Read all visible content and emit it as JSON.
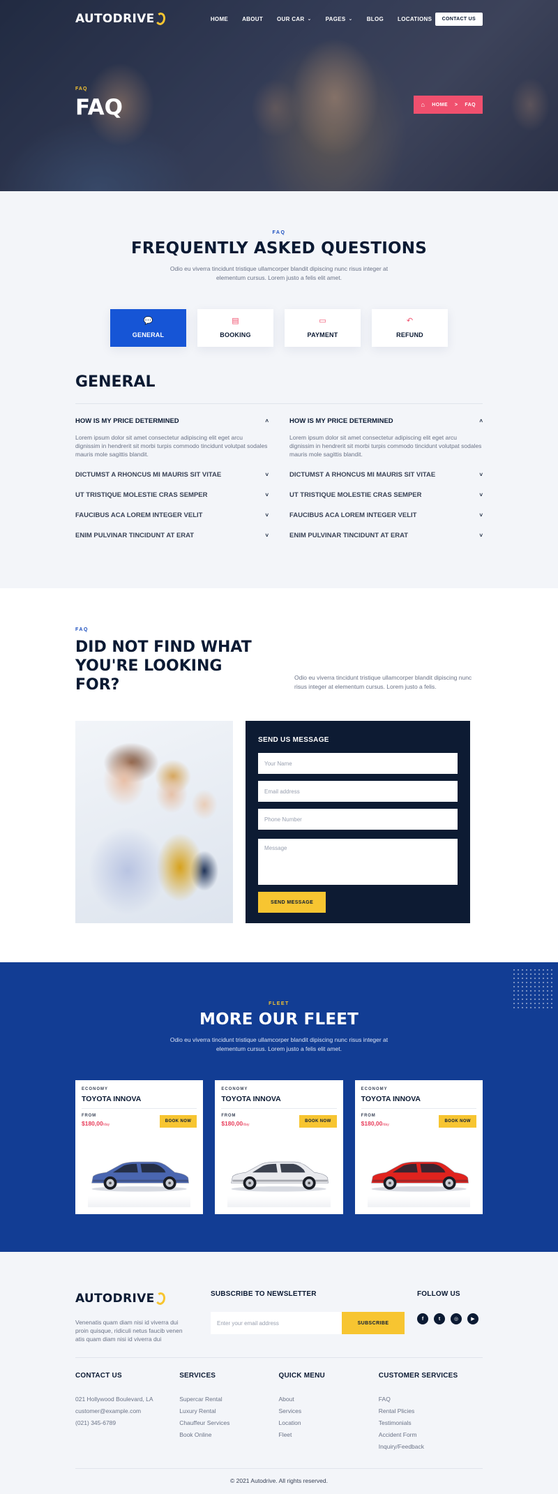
{
  "brand": {
    "name": "AUTODRIVE"
  },
  "nav": {
    "items": [
      {
        "label": "HOME",
        "dropdown": false
      },
      {
        "label": "ABOUT",
        "dropdown": false
      },
      {
        "label": "OUR CAR",
        "dropdown": true
      },
      {
        "label": "PAGES",
        "dropdown": true
      },
      {
        "label": "BLOG",
        "dropdown": false
      },
      {
        "label": "LOCATIONS",
        "dropdown": false
      }
    ],
    "cta": "CONTACT US"
  },
  "hero": {
    "eyebrow": "FAQ",
    "title": "FAQ",
    "breadcrumb": {
      "home": "HOME",
      "separator": ">",
      "current": "FAQ"
    }
  },
  "faq": {
    "eyebrow": "FAQ",
    "title": "FREQUENTLY ASKED QUESTIONS",
    "description": "Odio eu viverra tincidunt tristique ullamcorper blandit dipiscing nunc risus integer at elementum cursus. Lorem justo a felis elit amet.",
    "tabs": [
      {
        "label": "GENERAL",
        "icon": "chat-bubble-icon",
        "active": true
      },
      {
        "label": "BOOKING",
        "icon": "document-icon",
        "active": false
      },
      {
        "label": "PAYMENT",
        "icon": "card-icon",
        "active": false
      },
      {
        "label": "REFUND",
        "icon": "reply-arrow-icon",
        "active": false
      }
    ],
    "section_title": "GENERAL",
    "columns": [
      {
        "open_question": "HOW IS MY PRICE DETERMINED",
        "open_answer": "Lorem ipsum dolor sit amet consectetur adipiscing elit eget arcu dignissim in hendrerit sit morbi turpis commodo tincidunt volutpat sodales mauris mole sagittis blandit.",
        "questions": [
          "DICTUMST A RHONCUS MI MAURIS SIT VITAE",
          "UT TRISTIQUE MOLESTIE CRAS SEMPER",
          "FAUCIBUS ACA LOREM INTEGER VELIT",
          "ENIM PULVINAR TINCIDUNT AT ERAT"
        ]
      },
      {
        "open_question": "HOW IS MY PRICE DETERMINED",
        "open_answer": "Lorem ipsum dolor sit amet consectetur adipiscing elit eget arcu dignissim in hendrerit sit morbi turpis commodo tincidunt volutpat sodales mauris mole sagittis blandit.",
        "questions": [
          "DICTUMST A RHONCUS MI MAURIS SIT VITAE",
          "UT TRISTIQUE MOLESTIE CRAS SEMPER",
          "FAUCIBUS ACA LOREM INTEGER VELIT",
          "ENIM PULVINAR TINCIDUNT AT ERAT"
        ]
      }
    ]
  },
  "contact": {
    "eyebrow": "FAQ",
    "title": "DID NOT FIND WHAT YOU'RE LOOKING FOR?",
    "description": "Odio eu viverra tincidunt tristique ullamcorper blandit dipiscing nunc risus integer at elementum cursus. Lorem justo a felis.",
    "form": {
      "title": "SEND US MESSAGE",
      "name_placeholder": "Your Name",
      "email_placeholder": "Email address",
      "phone_placeholder": "Phone Number",
      "message_placeholder": "Message",
      "submit": "SEND MESSAGE"
    }
  },
  "fleet": {
    "eyebrow": "FLEET",
    "title": "MORE OUR FLEET",
    "description": "Odio eu viverra tincidunt tristique ullamcorper blandit dipiscing nunc risus integer at elementum cursus. Lorem justo a felis elit amet.",
    "cards": [
      {
        "category": "ECONOMY",
        "name": "TOYOTA INNOVA",
        "from": "FROM",
        "price": "$180,00",
        "unit": "/day",
        "button": "BOOK NOW",
        "car_color": "#4a66b0"
      },
      {
        "category": "ECONOMY",
        "name": "TOYOTA INNOVA",
        "from": "FROM",
        "price": "$180,00",
        "unit": "/day",
        "button": "BOOK NOW",
        "car_color": "#e9eaee"
      },
      {
        "category": "ECONOMY",
        "name": "TOYOTA INNOVA",
        "from": "FROM",
        "price": "$180,00",
        "unit": "/day",
        "button": "BOOK NOW",
        "car_color": "#e0231e"
      }
    ]
  },
  "footer": {
    "about": "Venenatis quam diam nisi id viverra dui proin quisque, ridiculi netus faucib venen atis quam diam nisi id viverra dui",
    "newsletter_title": "SUBSCRIBE TO NEWSLETTER",
    "newsletter_placeholder": "Enter your email address",
    "subscribe": "SUBSCRIBE",
    "follow_title": "FOLLOW US",
    "socials": [
      {
        "icon": "facebook-icon",
        "glyph": "f"
      },
      {
        "icon": "twitter-icon",
        "glyph": "t"
      },
      {
        "icon": "instagram-icon",
        "glyph": "◎"
      },
      {
        "icon": "youtube-icon",
        "glyph": "▶"
      }
    ],
    "columns": [
      {
        "title": "CONTACT US",
        "links": [
          "021 Hollywood Boulevard, LA",
          "customer@example.com",
          "(021) 345-6789"
        ]
      },
      {
        "title": "SERVICES",
        "links": [
          "Supercar Rental",
          "Luxury Rental",
          "Chauffeur Services",
          "Book Online"
        ]
      },
      {
        "title": "QUICK MENU",
        "links": [
          "About",
          "Services",
          "Location",
          "Fleet"
        ]
      },
      {
        "title": "CUSTOMER SERVICES",
        "links": [
          "FAQ",
          "Rental Plicies",
          "Testimonials",
          "Accident Form",
          "Inquiry/Feedback"
        ]
      }
    ],
    "copyright": "© 2021 Autodrive. All rights reserved."
  },
  "colors": {
    "accent": "#1655d6",
    "fleet_bg": "#123d94",
    "yellow": "#f7c531",
    "pink": "#f0506e",
    "navy": "#0d1b33"
  }
}
